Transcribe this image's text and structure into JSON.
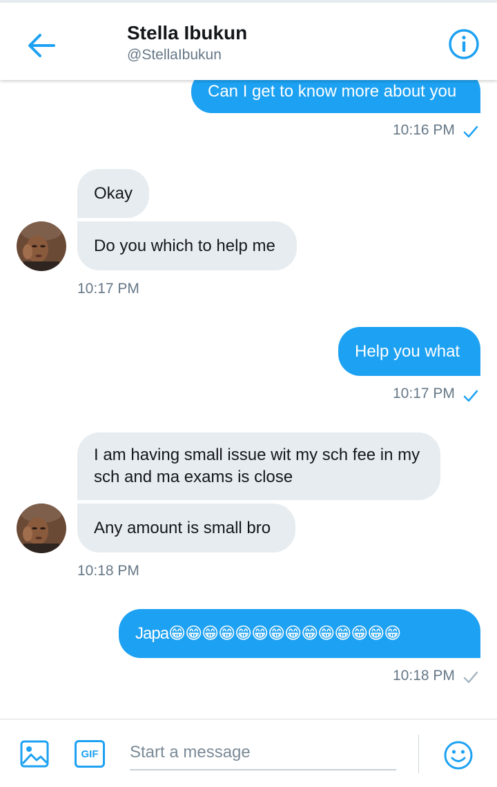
{
  "header": {
    "name": "Stella Ibukun",
    "handle": "@StellaIbukun"
  },
  "messages": [
    {
      "direction": "out",
      "text": "Can I get to know more about you",
      "time": "10:16 PM",
      "status": "read"
    },
    {
      "direction": "in",
      "texts": [
        "Okay",
        "Do you which to help me"
      ],
      "time": "10:17 PM"
    },
    {
      "direction": "out",
      "text": "Help you what",
      "time": "10:17 PM",
      "status": "read"
    },
    {
      "direction": "in",
      "texts": [
        "I am having small issue wit my sch fee in my sch and ma exams is close",
        "Any amount is small bro"
      ],
      "time": "10:18 PM"
    },
    {
      "direction": "out",
      "text": "Japa😁😁😁😁😁😁😁😁😁😁😁😁😁😁",
      "time": "10:18 PM",
      "status": "sent"
    }
  ],
  "composer": {
    "placeholder": "Start a message",
    "gif_label": "GIF"
  },
  "colors": {
    "accent": "#1da1f2",
    "incoming_bubble": "#e6ecf0",
    "muted_text": "#657786",
    "sent_check": "#aab8c2"
  },
  "icons": [
    "back-arrow-icon",
    "info-icon",
    "image-icon",
    "gif-icon",
    "emoji-icon",
    "checkmark-icon"
  ]
}
